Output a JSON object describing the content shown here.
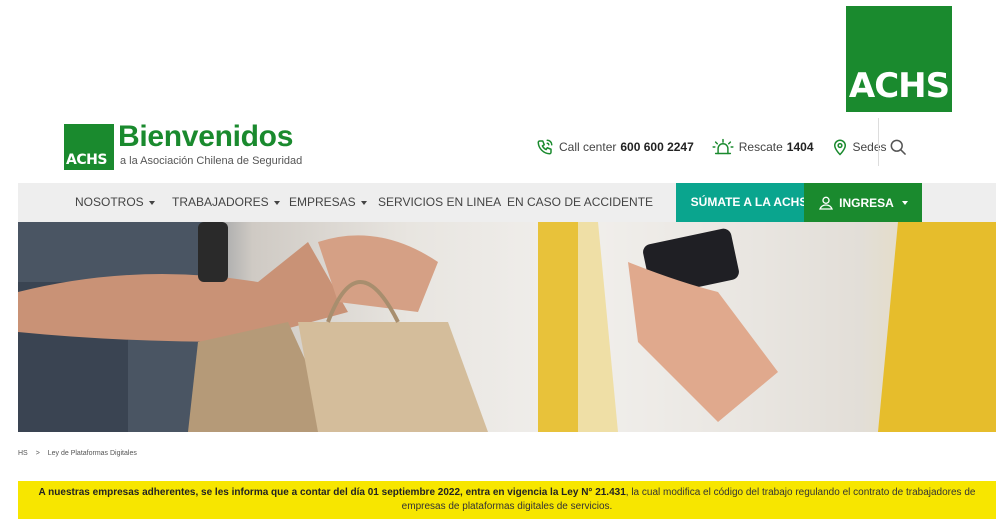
{
  "corner_logo": {
    "text": "ACHS"
  },
  "header": {
    "logo_box_text": "ACHS",
    "title": "Bienvenidos",
    "subtitle": "a la Asociación Chilena de Seguridad"
  },
  "utilities": {
    "call_center": {
      "label": "Call center",
      "number": "600 600 2247"
    },
    "rescate": {
      "label": "Rescate",
      "number": "1404"
    },
    "sedes": {
      "label": "Sedes"
    }
  },
  "nav": {
    "items": [
      {
        "label": "NOSOTROS",
        "dropdown": true
      },
      {
        "label": "TRABAJADORES",
        "dropdown": true
      },
      {
        "label": "EMPRESAS",
        "dropdown": true
      },
      {
        "label": "SERVICIOS EN LINEA",
        "dropdown": false
      },
      {
        "label": "EN CASO DE ACCIDENTE",
        "dropdown": false
      }
    ],
    "sumate_label": "SÚMATE A LA ACHS",
    "ingresa_label": "INGRESA"
  },
  "breadcrumb": {
    "root": "HS",
    "current": "Ley de Plataformas Digitales"
  },
  "notice": {
    "lead": "A nuestras empresas adherentes, se les informa que a contar del día 01 septiembre 2022, entra en vigencia la Ley N° 21.431",
    "rest": ", la cual modifica el código del trabajo regulando el contrato de trabajadores de empresas de plataformas digitales de servicios."
  },
  "colors": {
    "brand_green": "#1a8a2e",
    "teal": "#0aa58e",
    "notice_yellow": "#f7e600"
  }
}
